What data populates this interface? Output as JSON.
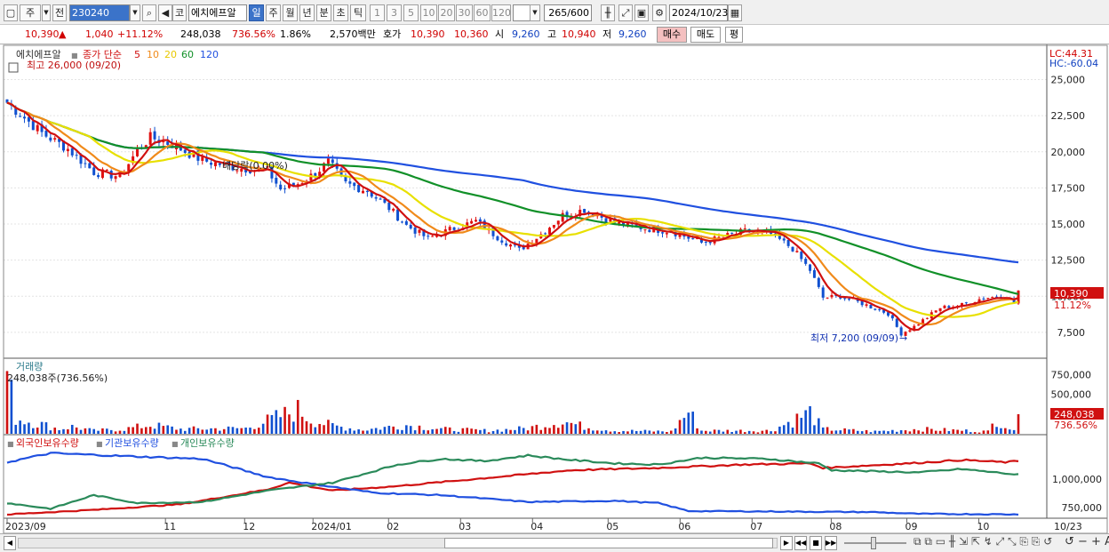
{
  "toolbar": {
    "type_label": "주",
    "prev_label": "전",
    "code": "230240",
    "market": "코",
    "name": "에치에프알",
    "periods": [
      "일",
      "주",
      "월",
      "년",
      "분",
      "초",
      "틱"
    ],
    "minutes": [
      "1",
      "3",
      "5",
      "10",
      "20",
      "30",
      "60",
      "120"
    ],
    "count": "265/600",
    "date": "2024/10/23"
  },
  "quote": {
    "price": "10,390",
    "change": "1,040",
    "change_pct": "+11.12%",
    "volume": "248,038",
    "volume_pct": "736.56%",
    "turnover": "1.86%",
    "amount": "2,570백만",
    "ask_label": "호가",
    "ask1": "10,390",
    "ask2": "10,360",
    "open_label": "시",
    "open": "9,260",
    "high_label": "고",
    "high": "10,940",
    "low_label": "저",
    "low": "9,260",
    "buy": "매수",
    "sell": "매도",
    "eval": "평"
  },
  "price_panel": {
    "title": "에치에프알",
    "legend_label": "종가 단순",
    "ma": [
      {
        "p": "5",
        "color": "#d01010"
      },
      {
        "p": "10",
        "color": "#f08a1a"
      },
      {
        "p": "20",
        "color": "#e8e000"
      },
      {
        "p": "60",
        "color": "#119028"
      },
      {
        "p": "120",
        "color": "#2050e0"
      }
    ],
    "high_note": "최고 26,000 (09/20)",
    "low_note": "최저 7,200 (09/09)",
    "dividend_note": "배당락(0.00%)",
    "lc": "LC:44.31",
    "hc": "HC:-60.04",
    "price_tag": "10,390",
    "pct_tag": "11.12%"
  },
  "volume_panel": {
    "title": "거래량",
    "note": "248,038주(736.56%)",
    "vol_tag": "248,038",
    "pct_tag": "736.56%"
  },
  "holder_panel": {
    "series": [
      {
        "name": "외국인보유수량",
        "color": "#d01010"
      },
      {
        "name": "기관보유수량",
        "color": "#2050e0"
      },
      {
        "name": "개인보유수량",
        "color": "#2a8a5a"
      }
    ]
  },
  "x_labels": [
    "2023/09",
    "11",
    "12",
    "2024/01",
    "02",
    "03",
    "04",
    "05",
    "06",
    "07",
    "08",
    "09",
    "10"
  ],
  "x_end_label": "10/23",
  "chart_data": {
    "type": "line",
    "price_axis": {
      "ticks": [
        25000,
        22500,
        20000,
        17500,
        15000,
        12500,
        10000,
        7500
      ],
      "range": [
        6200,
        26200
      ]
    },
    "volume_axis": {
      "ticks": [
        750000,
        500000,
        250000
      ],
      "range": [
        0,
        900000
      ]
    },
    "holder_axis": {
      "ticks": [
        1000000,
        750000
      ],
      "range": [
        680000,
        1260000
      ]
    },
    "close_anchors": [
      [
        0,
        23400
      ],
      [
        8,
        21300
      ],
      [
        14,
        20200
      ],
      [
        20,
        18600
      ],
      [
        26,
        18300
      ],
      [
        30,
        20100
      ],
      [
        33,
        21000
      ],
      [
        38,
        20500
      ],
      [
        45,
        19400
      ],
      [
        53,
        18900
      ],
      [
        60,
        18700
      ],
      [
        63,
        17400
      ],
      [
        67,
        17800
      ],
      [
        71,
        18500
      ],
      [
        74,
        19300
      ],
      [
        78,
        17800
      ],
      [
        83,
        17300
      ],
      [
        88,
        16100
      ],
      [
        92,
        14900
      ],
      [
        97,
        14000
      ],
      [
        102,
        14600
      ],
      [
        108,
        15200
      ],
      [
        113,
        14100
      ],
      [
        118,
        13200
      ],
      [
        123,
        14300
      ],
      [
        128,
        15600
      ],
      [
        133,
        16000
      ],
      [
        140,
        15100
      ],
      [
        147,
        14700
      ],
      [
        153,
        14500
      ],
      [
        160,
        13700
      ],
      [
        165,
        14100
      ],
      [
        170,
        14500
      ],
      [
        176,
        14300
      ],
      [
        181,
        13300
      ],
      [
        185,
        11800
      ],
      [
        188,
        9900
      ],
      [
        192,
        10000
      ],
      [
        197,
        9500
      ],
      [
        203,
        8800
      ],
      [
        206,
        7400
      ],
      [
        209,
        7900
      ],
      [
        215,
        9200
      ],
      [
        220,
        9400
      ],
      [
        225,
        9900
      ],
      [
        230,
        10000
      ],
      [
        232,
        9500
      ],
      [
        233,
        10390
      ]
    ],
    "volume_anchors": [
      [
        0,
        750000
      ],
      [
        2,
        200000
      ],
      [
        8,
        120000
      ],
      [
        12,
        60000
      ],
      [
        15,
        90000
      ],
      [
        20,
        40000
      ],
      [
        27,
        60000
      ],
      [
        33,
        110000
      ],
      [
        40,
        60000
      ],
      [
        55,
        70000
      ],
      [
        67,
        300000
      ],
      [
        70,
        180000
      ],
      [
        75,
        100000
      ],
      [
        82,
        50000
      ],
      [
        92,
        110000
      ],
      [
        100,
        60000
      ],
      [
        111,
        40000
      ],
      [
        120,
        70000
      ],
      [
        128,
        160000
      ],
      [
        133,
        90000
      ],
      [
        140,
        40000
      ],
      [
        153,
        30000
      ],
      [
        157,
        280000
      ],
      [
        160,
        40000
      ],
      [
        176,
        40000
      ],
      [
        185,
        270000
      ],
      [
        188,
        60000
      ],
      [
        200,
        30000
      ],
      [
        210,
        60000
      ],
      [
        221,
        40000
      ],
      [
        226,
        30000
      ],
      [
        228,
        190000
      ],
      [
        232,
        30000
      ],
      [
        233,
        248038
      ]
    ],
    "foreign": [
      [
        0,
        690000
      ],
      [
        20,
        730000
      ],
      [
        40,
        780000
      ],
      [
        60,
        910000
      ],
      [
        65,
        970000
      ],
      [
        75,
        900000
      ],
      [
        90,
        940000
      ],
      [
        110,
        1010000
      ],
      [
        130,
        1080000
      ],
      [
        150,
        1100000
      ],
      [
        170,
        1130000
      ],
      [
        185,
        1140000
      ],
      [
        188,
        1100000
      ],
      [
        210,
        1145000
      ],
      [
        220,
        1170000
      ],
      [
        230,
        1150000
      ],
      [
        233,
        1160000
      ]
    ],
    "institution": [
      [
        0,
        1150000
      ],
      [
        10,
        1230000
      ],
      [
        30,
        1200000
      ],
      [
        45,
        1180000
      ],
      [
        60,
        1020000
      ],
      [
        70,
        960000
      ],
      [
        85,
        880000
      ],
      [
        100,
        860000
      ],
      [
        120,
        800000
      ],
      [
        140,
        810000
      ],
      [
        150,
        790000
      ],
      [
        157,
        720000
      ],
      [
        180,
        715000
      ],
      [
        200,
        710000
      ],
      [
        210,
        695000
      ],
      [
        233,
        690000
      ]
    ],
    "individual": [
      [
        0,
        790000
      ],
      [
        10,
        740000
      ],
      [
        20,
        860000
      ],
      [
        30,
        790000
      ],
      [
        45,
        800000
      ],
      [
        60,
        900000
      ],
      [
        75,
        970000
      ],
      [
        90,
        1130000
      ],
      [
        100,
        1180000
      ],
      [
        110,
        1160000
      ],
      [
        120,
        1210000
      ],
      [
        130,
        1170000
      ],
      [
        140,
        1140000
      ],
      [
        150,
        1130000
      ],
      [
        160,
        1190000
      ],
      [
        175,
        1180000
      ],
      [
        187,
        1140000
      ],
      [
        190,
        1080000
      ],
      [
        210,
        1060000
      ],
      [
        220,
        1090000
      ],
      [
        233,
        1040000
      ]
    ]
  }
}
